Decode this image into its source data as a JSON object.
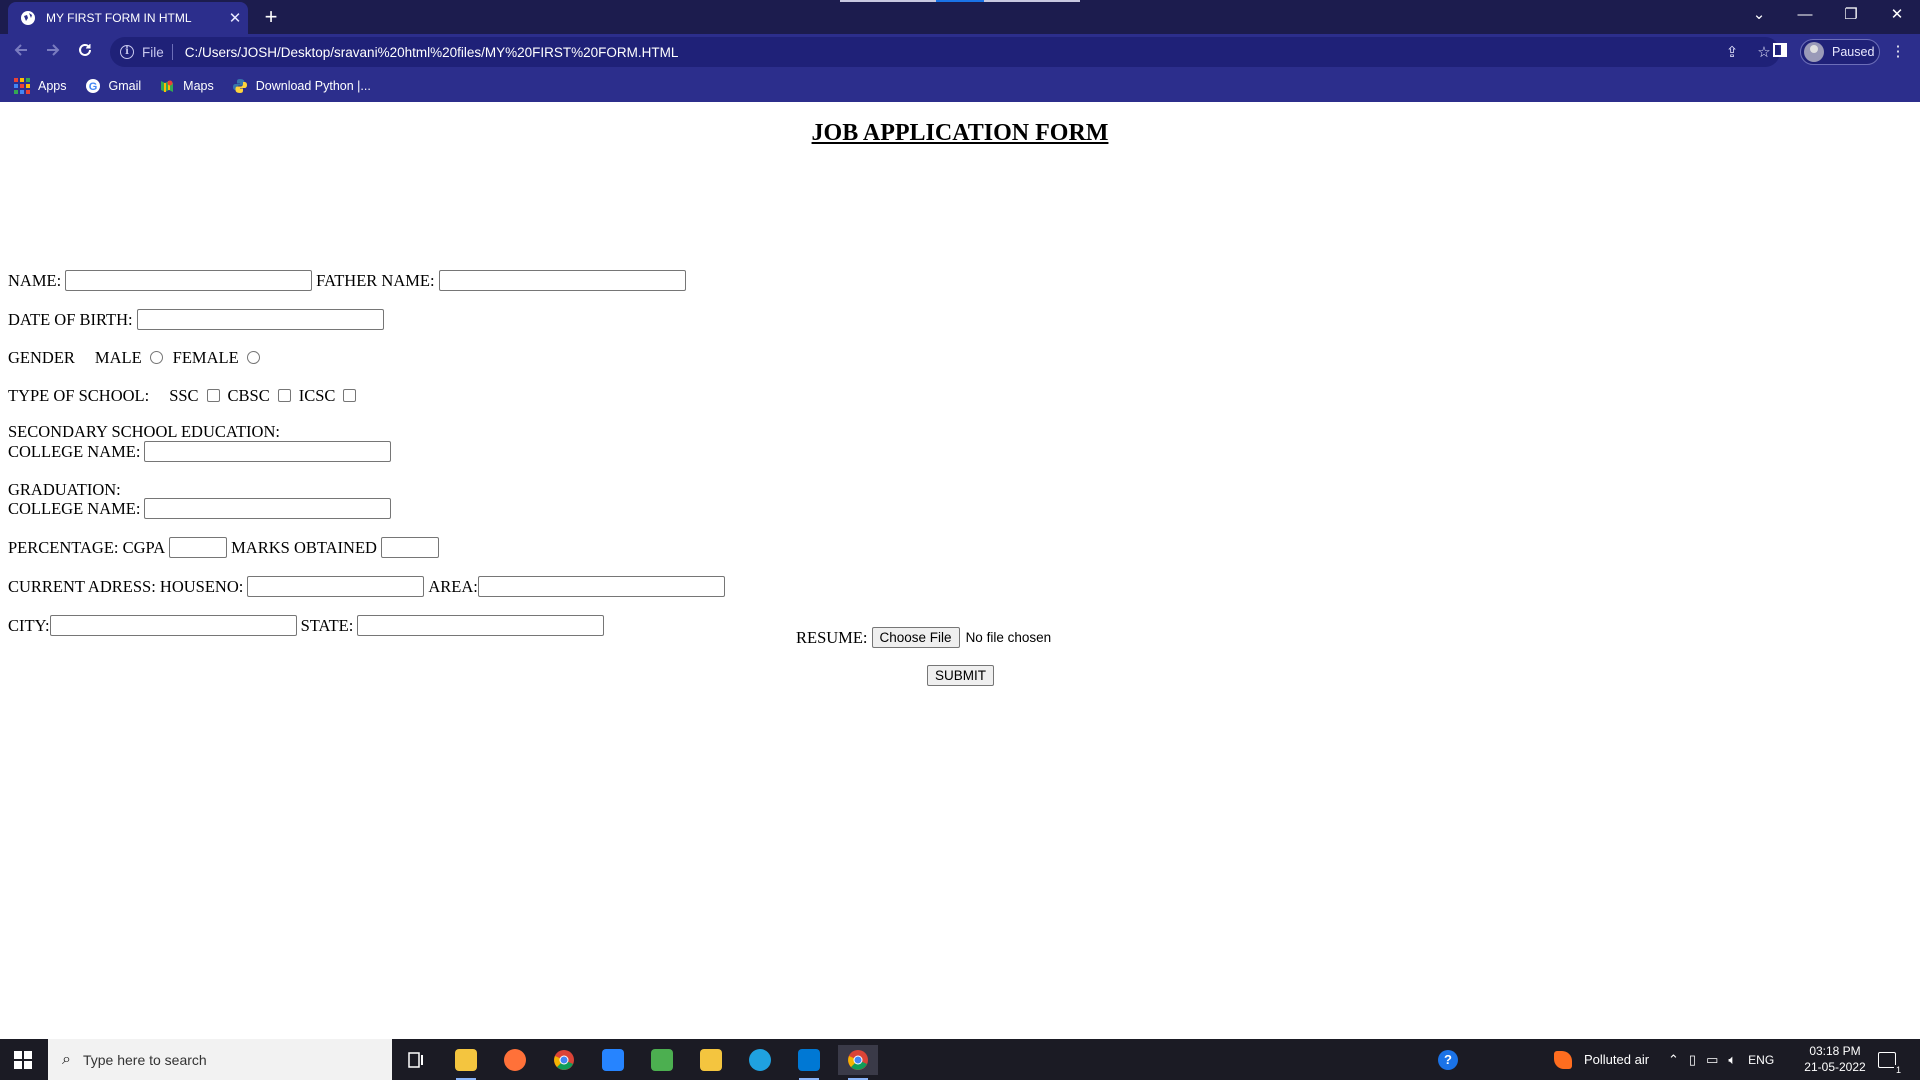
{
  "browser": {
    "tab_title": "MY FIRST FORM IN HTML",
    "tab_close": "✕",
    "new_tab": "+",
    "scheme": "File",
    "url": "C:/Users/JOSH/Desktop/sravani%20html%20files/MY%20FIRST%20FORM.HTML",
    "profile_status": "Paused",
    "window_controls": [
      "⌄",
      "—",
      "❐",
      "✕"
    ],
    "colors": {
      "tabstrip": "#1c1c4e",
      "toolbar": "#2c2e8c"
    }
  },
  "bookmarks": [
    {
      "label": "Apps",
      "icon": "apps-grid-icon"
    },
    {
      "label": "Gmail",
      "icon": "google-icon"
    },
    {
      "label": "Maps",
      "icon": "maps-icon"
    },
    {
      "label": "Download Python |...",
      "icon": "python-icon"
    }
  ],
  "form": {
    "heading": "JOB APPLICATION FORM",
    "name_label": "NAME:",
    "father_name_label": "FATHER NAME:",
    "dob_label": "DATE OF BIRTH:",
    "gender_label": "GENDER",
    "male_label": "MALE",
    "female_label": "FEMALE",
    "school_type_label": "TYPE OF SCHOOL:",
    "school_options": [
      "SSC",
      "CBSC",
      "ICSC"
    ],
    "secondary_label": "SECONDARY SCHOOL EDUCATION:",
    "college_name_label": "COLLEGE NAME:",
    "graduation_label": "GRADUATION:",
    "college_name_label_2": "COLLEGE NAME:",
    "percentage_label": "PERCENTAGE: CGPA",
    "marks_label": "MARKS OBTAINED",
    "address_label": "CURRENT ADRESS: HOUSENO:",
    "area_label": "AREA:",
    "city_label": "CITY:",
    "state_label": "STATE:",
    "resume_label": "RESUME:",
    "choose_file": "Choose File",
    "no_file": "No file chosen",
    "submit": "SUBMIT"
  },
  "taskbar": {
    "search_placeholder": "Type here to search",
    "weather": "Polluted air",
    "language": "ENG",
    "time": "03:18 PM",
    "date": "21-05-2022",
    "notification_count": "1"
  }
}
